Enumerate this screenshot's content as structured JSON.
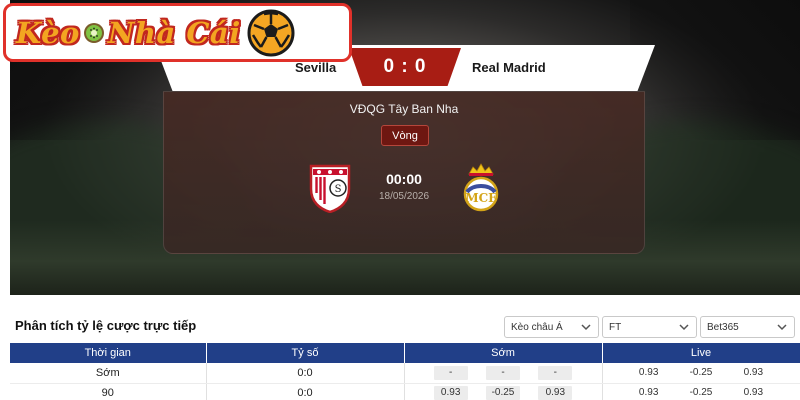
{
  "brand": {
    "name_part1": "Kèo",
    "name_part2": "Nhà Cái"
  },
  "match": {
    "home_team": "Sevilla",
    "away_team": "Real Madrid",
    "score": "0 : 0",
    "league": "VĐQG Tây Ban Nha",
    "round_label": "Vòng",
    "kickoff_time": "00:00",
    "date": "18/05/2026"
  },
  "odds": {
    "title": "Phân tích tỷ lệ cược trực tiếp",
    "filters": {
      "market": "Kèo châu Á",
      "period": "FT",
      "bookmaker": "Bet365"
    },
    "headers": [
      "Thời gian",
      "Tỷ số",
      "Sớm",
      "Live"
    ],
    "rows": [
      {
        "time": "Sớm",
        "score": "0:0",
        "early": [
          "-",
          "-",
          "-"
        ],
        "live": [
          "0.93",
          "-0.25",
          "0.93"
        ]
      },
      {
        "time": "90",
        "score": "0:0",
        "early": [
          "0.93",
          "-0.25",
          "0.93"
        ],
        "live": [
          "0.93",
          "-0.25",
          "0.93"
        ]
      }
    ]
  },
  "colors": {
    "accent_red": "#a81d14",
    "table_header": "#213f88",
    "brand_orange": "#f3a521"
  }
}
